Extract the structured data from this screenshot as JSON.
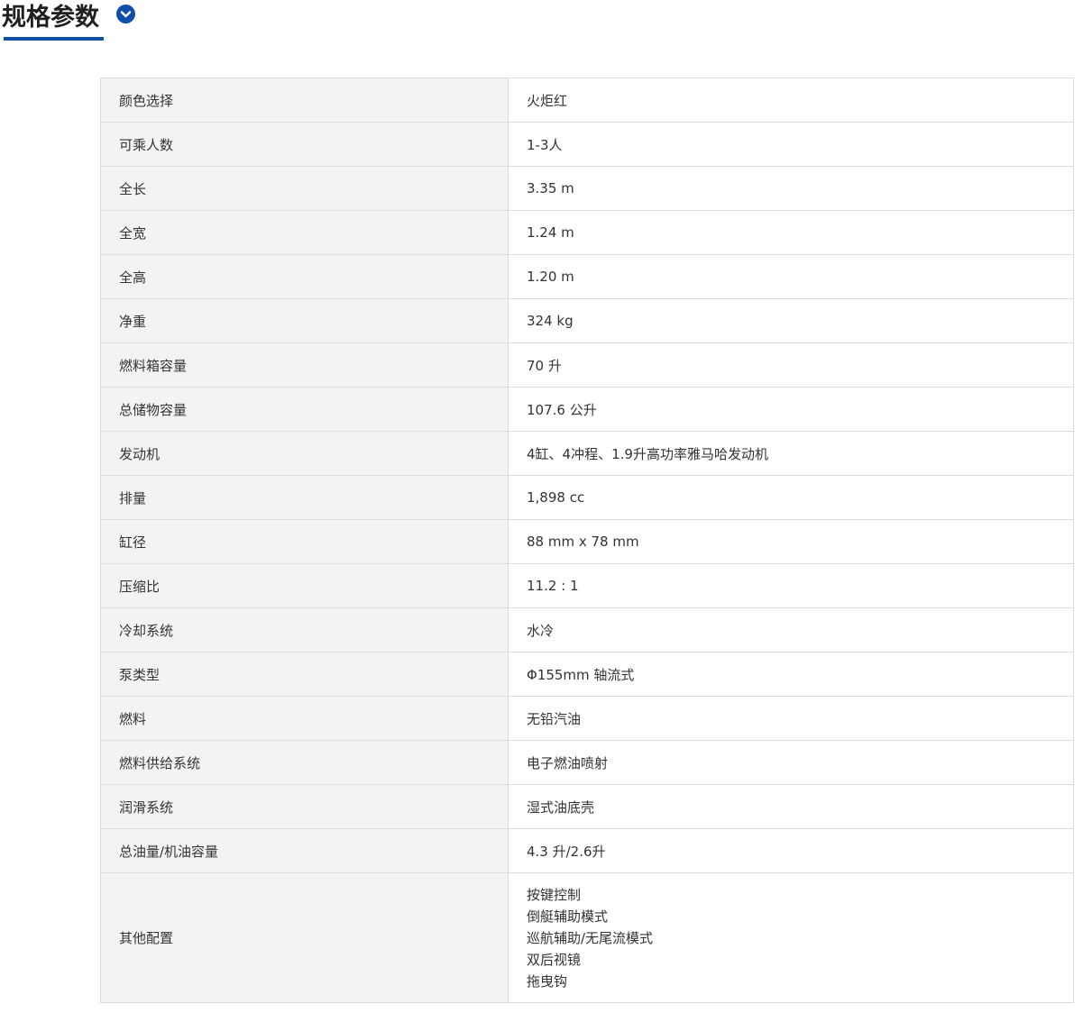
{
  "header": {
    "title": "规格参数",
    "toggle_icon": "chevron-down-icon",
    "accent_color": "#0f4fa8"
  },
  "specs": [
    {
      "label": "颜色选择",
      "value": "火炬红"
    },
    {
      "label": "可乘人数",
      "value": "1-3人"
    },
    {
      "label": "全长",
      "value": "3.35 m"
    },
    {
      "label": "全宽",
      "value": "1.24 m"
    },
    {
      "label": "全高",
      "value": "1.20 m"
    },
    {
      "label": "净重",
      "value": "324 kg"
    },
    {
      "label": "燃料箱容量",
      "value": "70 升"
    },
    {
      "label": "总储物容量",
      "value": "107.6 公升"
    },
    {
      "label": "发动机",
      "value": "4缸、4冲程、1.9升高功率雅马哈发动机"
    },
    {
      "label": "排量",
      "value": "1,898 cc"
    },
    {
      "label": "缸径",
      "value": "88 mm x 78 mm"
    },
    {
      "label": "压缩比",
      "value": "11.2 : 1"
    },
    {
      "label": "冷却系统",
      "value": "水冷"
    },
    {
      "label": "泵类型",
      "value": "Φ155mm 轴流式"
    },
    {
      "label": "燃料",
      "value": "无铅汽油"
    },
    {
      "label": "燃料供给系统",
      "value": "电子燃油喷射"
    },
    {
      "label": "润滑系统",
      "value": "湿式油底壳"
    },
    {
      "label": "总油量/机油容量",
      "value": "4.3 升/2.6升"
    }
  ],
  "other": {
    "label": "其他配置",
    "lines": [
      "按键控制",
      "倒艇辅助模式",
      "巡航辅助/无尾流模式",
      "双后视镜",
      "拖曳钩"
    ]
  }
}
